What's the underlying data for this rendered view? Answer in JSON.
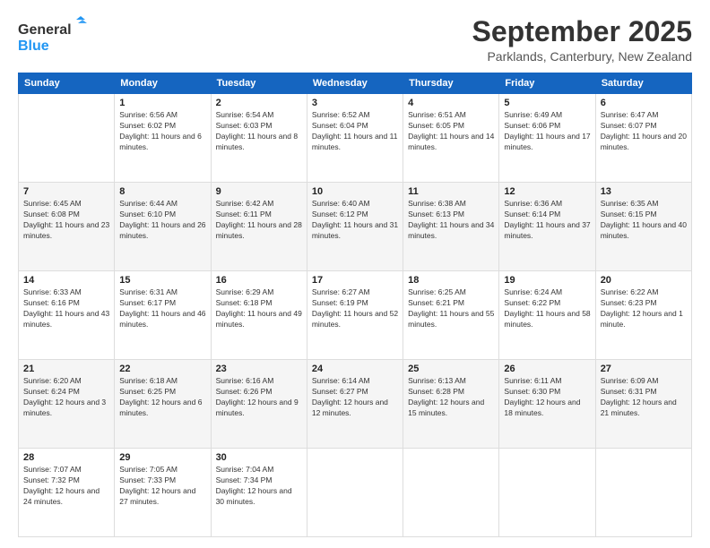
{
  "logo": {
    "line1": "General",
    "line2": "Blue"
  },
  "header": {
    "title": "September 2025",
    "subtitle": "Parklands, Canterbury, New Zealand"
  },
  "days_of_week": [
    "Sunday",
    "Monday",
    "Tuesday",
    "Wednesday",
    "Thursday",
    "Friday",
    "Saturday"
  ],
  "weeks": [
    [
      null,
      {
        "day": 1,
        "sunrise": "6:56 AM",
        "sunset": "6:02 PM",
        "daylight": "11 hours and 6 minutes."
      },
      {
        "day": 2,
        "sunrise": "6:54 AM",
        "sunset": "6:03 PM",
        "daylight": "11 hours and 8 minutes."
      },
      {
        "day": 3,
        "sunrise": "6:52 AM",
        "sunset": "6:04 PM",
        "daylight": "11 hours and 11 minutes."
      },
      {
        "day": 4,
        "sunrise": "6:51 AM",
        "sunset": "6:05 PM",
        "daylight": "11 hours and 14 minutes."
      },
      {
        "day": 5,
        "sunrise": "6:49 AM",
        "sunset": "6:06 PM",
        "daylight": "11 hours and 17 minutes."
      },
      {
        "day": 6,
        "sunrise": "6:47 AM",
        "sunset": "6:07 PM",
        "daylight": "11 hours and 20 minutes."
      }
    ],
    [
      {
        "day": 7,
        "sunrise": "6:45 AM",
        "sunset": "6:08 PM",
        "daylight": "11 hours and 23 minutes."
      },
      {
        "day": 8,
        "sunrise": "6:44 AM",
        "sunset": "6:10 PM",
        "daylight": "11 hours and 26 minutes."
      },
      {
        "day": 9,
        "sunrise": "6:42 AM",
        "sunset": "6:11 PM",
        "daylight": "11 hours and 28 minutes."
      },
      {
        "day": 10,
        "sunrise": "6:40 AM",
        "sunset": "6:12 PM",
        "daylight": "11 hours and 31 minutes."
      },
      {
        "day": 11,
        "sunrise": "6:38 AM",
        "sunset": "6:13 PM",
        "daylight": "11 hours and 34 minutes."
      },
      {
        "day": 12,
        "sunrise": "6:36 AM",
        "sunset": "6:14 PM",
        "daylight": "11 hours and 37 minutes."
      },
      {
        "day": 13,
        "sunrise": "6:35 AM",
        "sunset": "6:15 PM",
        "daylight": "11 hours and 40 minutes."
      }
    ],
    [
      {
        "day": 14,
        "sunrise": "6:33 AM",
        "sunset": "6:16 PM",
        "daylight": "11 hours and 43 minutes."
      },
      {
        "day": 15,
        "sunrise": "6:31 AM",
        "sunset": "6:17 PM",
        "daylight": "11 hours and 46 minutes."
      },
      {
        "day": 16,
        "sunrise": "6:29 AM",
        "sunset": "6:18 PM",
        "daylight": "11 hours and 49 minutes."
      },
      {
        "day": 17,
        "sunrise": "6:27 AM",
        "sunset": "6:19 PM",
        "daylight": "11 hours and 52 minutes."
      },
      {
        "day": 18,
        "sunrise": "6:25 AM",
        "sunset": "6:21 PM",
        "daylight": "11 hours and 55 minutes."
      },
      {
        "day": 19,
        "sunrise": "6:24 AM",
        "sunset": "6:22 PM",
        "daylight": "11 hours and 58 minutes."
      },
      {
        "day": 20,
        "sunrise": "6:22 AM",
        "sunset": "6:23 PM",
        "daylight": "12 hours and 1 minute."
      }
    ],
    [
      {
        "day": 21,
        "sunrise": "6:20 AM",
        "sunset": "6:24 PM",
        "daylight": "12 hours and 3 minutes."
      },
      {
        "day": 22,
        "sunrise": "6:18 AM",
        "sunset": "6:25 PM",
        "daylight": "12 hours and 6 minutes."
      },
      {
        "day": 23,
        "sunrise": "6:16 AM",
        "sunset": "6:26 PM",
        "daylight": "12 hours and 9 minutes."
      },
      {
        "day": 24,
        "sunrise": "6:14 AM",
        "sunset": "6:27 PM",
        "daylight": "12 hours and 12 minutes."
      },
      {
        "day": 25,
        "sunrise": "6:13 AM",
        "sunset": "6:28 PM",
        "daylight": "12 hours and 15 minutes."
      },
      {
        "day": 26,
        "sunrise": "6:11 AM",
        "sunset": "6:30 PM",
        "daylight": "12 hours and 18 minutes."
      },
      {
        "day": 27,
        "sunrise": "6:09 AM",
        "sunset": "6:31 PM",
        "daylight": "12 hours and 21 minutes."
      }
    ],
    [
      {
        "day": 28,
        "sunrise": "7:07 AM",
        "sunset": "7:32 PM",
        "daylight": "12 hours and 24 minutes."
      },
      {
        "day": 29,
        "sunrise": "7:05 AM",
        "sunset": "7:33 PM",
        "daylight": "12 hours and 27 minutes."
      },
      {
        "day": 30,
        "sunrise": "7:04 AM",
        "sunset": "7:34 PM",
        "daylight": "12 hours and 30 minutes."
      },
      null,
      null,
      null,
      null
    ]
  ],
  "labels": {
    "sunrise": "Sunrise:",
    "sunset": "Sunset:",
    "daylight": "Daylight:"
  }
}
